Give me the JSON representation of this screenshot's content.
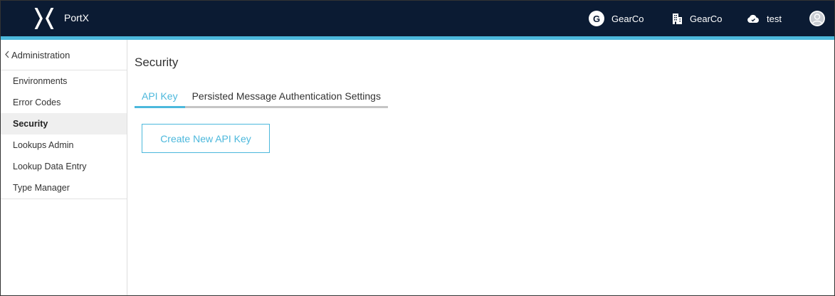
{
  "header": {
    "brand": "PortX",
    "org_initial": "G",
    "org_name": "GearCo",
    "company_name": "GearCo",
    "environment_name": "test",
    "colors": {
      "background": "#0b1b33",
      "accent": "#4cb8dc"
    }
  },
  "sidebar": {
    "back_label": "Administration",
    "items": [
      {
        "label": "Environments"
      },
      {
        "label": "Error Codes"
      },
      {
        "label": "Security",
        "active": true
      },
      {
        "label": "Lookups Admin"
      },
      {
        "label": "Lookup Data Entry"
      },
      {
        "label": "Type Manager"
      }
    ]
  },
  "main": {
    "title": "Security",
    "tabs": [
      {
        "label": "API Key",
        "active": true
      },
      {
        "label": "Persisted Message Authentication Settings"
      }
    ],
    "create_button": "Create New API Key"
  },
  "icons": [
    "portx-logo-icon",
    "building-icon",
    "cloud-icon",
    "user-avatar-icon",
    "chevron-left-icon"
  ]
}
